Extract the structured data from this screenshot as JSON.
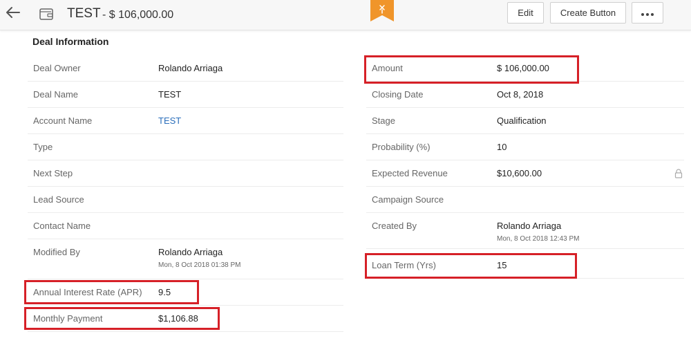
{
  "header": {
    "title": "TEST",
    "amount": "- $ 106,000.00",
    "edit_label": "Edit",
    "create_button_label": "Create Button"
  },
  "icons": {
    "back": "back-arrow-icon",
    "wallet": "wallet-icon",
    "ribbon": "ribbon-icon",
    "more": "more-dots-icon",
    "lock": "lock-icon"
  },
  "colors": {
    "highlight": "#d62027",
    "link": "#2a6ebb",
    "ribbon": "#f0952a"
  },
  "section": {
    "title": "Deal Information"
  },
  "left": {
    "deal_owner": {
      "label": "Deal Owner",
      "value": "Rolando Arriaga"
    },
    "deal_name": {
      "label": "Deal Name",
      "value": "TEST"
    },
    "account_name": {
      "label": "Account Name",
      "value": "TEST"
    },
    "type": {
      "label": "Type",
      "value": ""
    },
    "next_step": {
      "label": "Next Step",
      "value": ""
    },
    "lead_source": {
      "label": "Lead Source",
      "value": ""
    },
    "contact_name": {
      "label": "Contact Name",
      "value": ""
    },
    "modified_by": {
      "label": "Modified By",
      "value": "Rolando Arriaga",
      "sub": "Mon, 8 Oct 2018 01:38 PM"
    },
    "annual_interest_rate": {
      "label": "Annual Interest Rate (APR)",
      "value": "9.5"
    },
    "monthly_payment": {
      "label": "Monthly Payment",
      "value": "$1,106.88"
    }
  },
  "right": {
    "amount": {
      "label": "Amount",
      "value": "$ 106,000.00"
    },
    "closing_date": {
      "label": "Closing Date",
      "value": "Oct 8, 2018"
    },
    "stage": {
      "label": "Stage",
      "value": "Qualification"
    },
    "probability": {
      "label": "Probability (%)",
      "value": "10"
    },
    "expected_revenue": {
      "label": "Expected Revenue",
      "value": "$10,600.00"
    },
    "campaign_source": {
      "label": "Campaign Source",
      "value": ""
    },
    "created_by": {
      "label": "Created By",
      "value": "Rolando Arriaga",
      "sub": "Mon, 8 Oct 2018 12:43 PM"
    },
    "loan_term": {
      "label": "Loan Term (Yrs)",
      "value": "15"
    }
  }
}
